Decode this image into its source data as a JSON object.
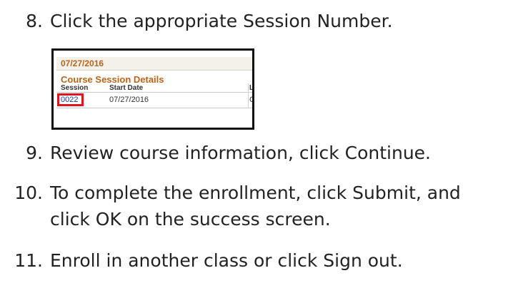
{
  "steps": [
    {
      "number": "8.",
      "text": "Click the appropriate Session Number."
    },
    {
      "number": "9.",
      "text": "Review course information, click Continue."
    },
    {
      "number": "10.",
      "text": "To complete the enrollment, click Submit, and",
      "text_cont": "click OK on the success screen."
    },
    {
      "number": "11.",
      "text": "Enroll in another class or click Sign out."
    }
  ],
  "screenshot": {
    "date_header": "07/27/2016",
    "section_title": "Course Session Details",
    "columns": [
      "Session",
      "Start Date",
      "L"
    ],
    "row": {
      "session": "0022",
      "start_date": "07/27/2016",
      "third": "C"
    }
  },
  "colors": {
    "accent_orange": "#b8631a",
    "highlight_red": "#e0141e",
    "link_blue": "#1a3a9a"
  }
}
